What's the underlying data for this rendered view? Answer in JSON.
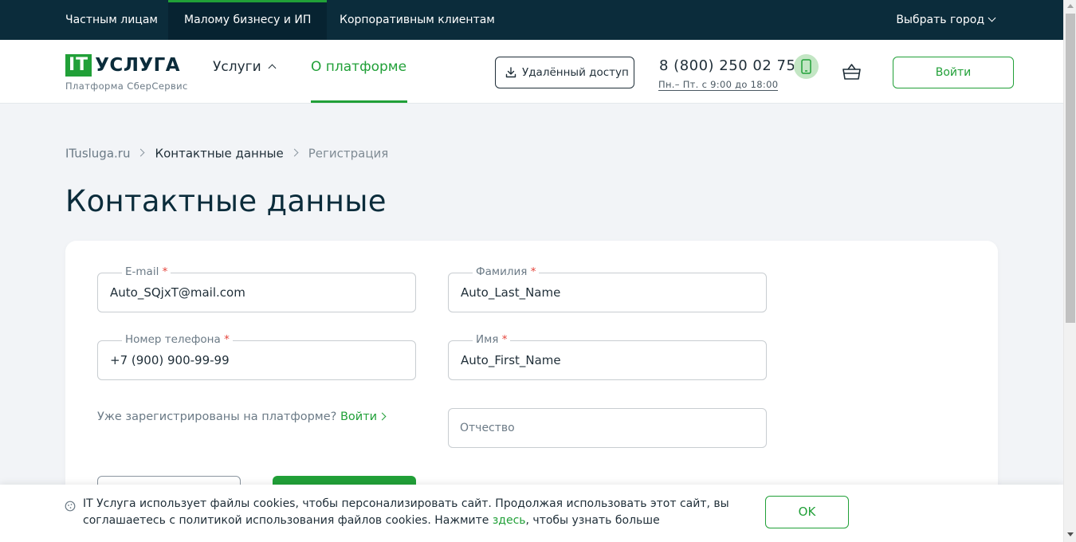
{
  "topbar": {
    "segments": [
      "Частным лицам",
      "Малому бизнесу и ИП",
      "Корпоративным клиентам"
    ],
    "active_segment": "Малому бизнесу и ИП",
    "city_label": "Выбрать город"
  },
  "header": {
    "logo_box": "IT",
    "logo_word": "УСЛУГА",
    "logo_subtitle": "Платформа СберСервис",
    "nav": {
      "services": "Услуги",
      "platform": "О платформе"
    },
    "remote_access": "Удалённый доступ",
    "phone": "8 (800) 250 02 75",
    "hours": "Пн.– Пт. с 9:00 до 18:00",
    "login": "Войти"
  },
  "breadcrumb": {
    "home": "ITusluga.ru",
    "contacts": "Контактные данные",
    "current": "Регистрация"
  },
  "page_title": "Контактные данные",
  "form": {
    "email": {
      "label": "E-mail",
      "required_mark": "*",
      "value": "Auto_SQjxT@mail.com"
    },
    "last_name": {
      "label": "Фамилия",
      "required_mark": "*",
      "value": "Auto_Last_Name"
    },
    "phone": {
      "label": "Номер телефона",
      "required_mark": "*",
      "value": "+7 (900) 900-99-99"
    },
    "first_name": {
      "label": "Имя",
      "required_mark": "*",
      "value": "Auto_First_Name"
    },
    "patronymic": {
      "placeholder": "Отчество"
    },
    "already_registered": "Уже зарегистрированы на платформе?",
    "login_link": "Войти"
  },
  "cookie": {
    "text_before": "IT Услуга использует файлы cookies, чтобы персонализировать сайт. Продолжая использовать этот сайт, вы соглашаетесь с политикой использования файлов cookies. Нажмите ",
    "link": "здесь",
    "text_after": ", чтобы узнать больше",
    "ok": "OK"
  },
  "colors": {
    "brand_green": "#21a038",
    "topbar_bg": "#0b2c3b",
    "page_bg": "#f2f4f7",
    "required_red": "#e5443b"
  },
  "icons": [
    "download-icon",
    "smartphone-icon",
    "basket-icon",
    "info-icon",
    "chevron-down-icon",
    "chevron-up-icon",
    "chevron-right-icon"
  ]
}
